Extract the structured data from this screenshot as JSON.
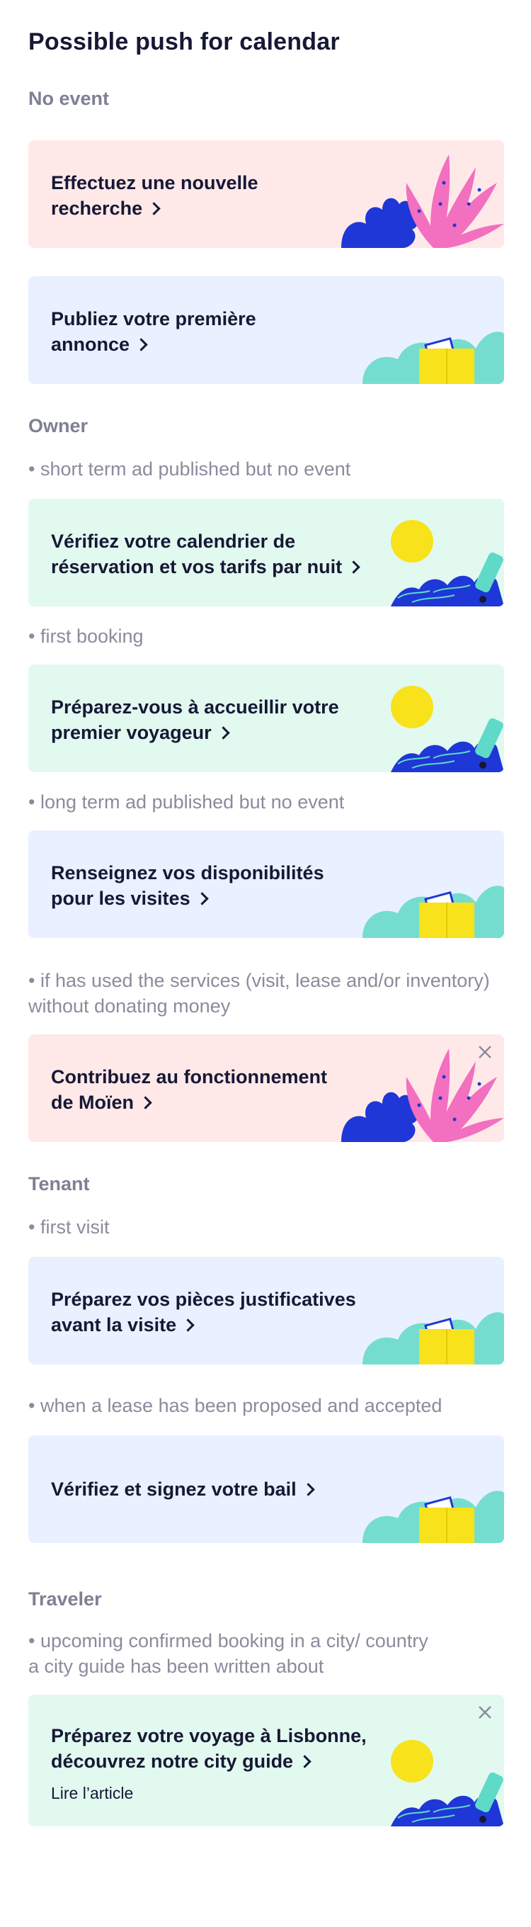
{
  "title": "Possible push for calendar",
  "sections": {
    "no_event": "No event",
    "owner": "Owner",
    "tenant": "Tenant",
    "traveler": "Traveler"
  },
  "notes": {
    "short_term": "• short term ad published but no event",
    "first_booking": "• first booking",
    "long_term": "• long term ad published but no event",
    "services_1": "• if has used the services (visit, lease and/or inventory)",
    "services_2": "without donating money",
    "first_visit": "• first visit",
    "lease": "• when a lease has been proposed and accepted",
    "upcoming_1": "• upcoming confirmed booking in a city/ country",
    "upcoming_2": "a city guide has been written about"
  },
  "cards": {
    "new_search": {
      "line1": "Effectuez une nouvelle",
      "line2": "recherche"
    },
    "first_ad": {
      "line1": "Publiez votre première",
      "line2": "annonce"
    },
    "check_calendar": {
      "line1": "Vérifiez votre calendrier de",
      "line2": "réservation et vos tarifs par nuit"
    },
    "welcome_traveler": {
      "line1": "Préparez-vous à accueillir votre",
      "line2": "premier voyageur"
    },
    "availability": {
      "line1": "Renseignez vos disponibilités",
      "line2": "pour les visites"
    },
    "contribute": {
      "line1": "Contribuez au fonctionnement",
      "line2": "de Moïen"
    },
    "documents": {
      "line1": "Préparez vos pièces justificatives",
      "line2": "avant la visite"
    },
    "sign_lease": {
      "line1": "Vérifiez et signez votre bail"
    },
    "city_guide": {
      "line1": "Préparez votre voyage à Lisbonne,",
      "line2": "découvrez notre city guide",
      "link": "Lire l’article"
    }
  },
  "colors": {
    "pink_bg": "#ffe9e8",
    "blue_bg": "#e9f0ff",
    "green_bg": "#e2f9ef",
    "accent_blue": "#1e37d6",
    "accent_pink": "#f36fbf",
    "accent_yellow": "#f7e21b",
    "accent_teal": "#5fd9c8"
  },
  "icons": [
    "chevron-right-icon",
    "close-icon",
    "plant-illustration",
    "box-illustration",
    "sun-wave-illustration"
  ]
}
